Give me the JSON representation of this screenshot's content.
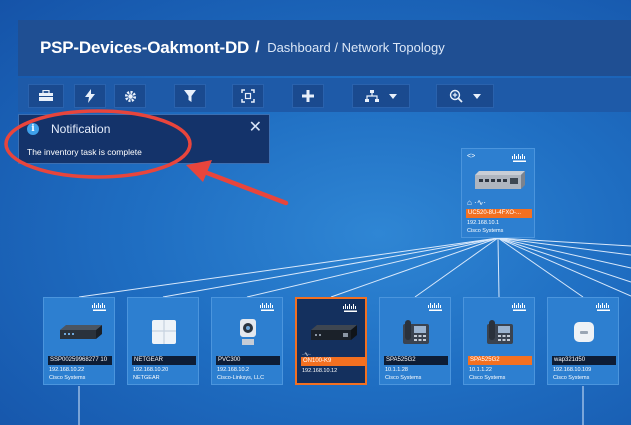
{
  "header": {
    "title": "PSP-Devices-Oakmont-DD",
    "breadcrumb_sep": "/",
    "breadcrumb": "Dashboard / Network Topology"
  },
  "toolbar": {
    "buttons": [
      {
        "icon": "toolbox-icon"
      },
      {
        "icon": "lightning-icon"
      },
      {
        "icon": "gear-icon"
      },
      {
        "icon": "filter-icon"
      },
      {
        "icon": "fit-screen-icon"
      },
      {
        "icon": "plus-icon"
      },
      {
        "icon": "layout-tree-icon"
      },
      {
        "icon": "zoom-in-icon"
      }
    ]
  },
  "notification": {
    "title": "Notification",
    "message": "The inventory task is complete",
    "close": "✕",
    "info": "i"
  },
  "root_device": {
    "code": "<>",
    "status": "⌂ ·∿·",
    "name": "UC520-8U-4FXO-...",
    "ip": "192.168.10.1",
    "vendor": "Cisco Systems"
  },
  "devices": [
    {
      "name": "SSP00259968277 10",
      "ip": "192.168.10.22",
      "vendor": "Cisco Systems",
      "kind": "switch",
      "highlight": false
    },
    {
      "name": "NETGEAR",
      "ip": "192.168.10.20",
      "vendor": "NETGEAR",
      "kind": "box",
      "highlight": false
    },
    {
      "name": "PVC300",
      "ip": "192.168.10.2",
      "vendor": "Cisco-Linksys, LLC",
      "kind": "camera",
      "highlight": false
    },
    {
      "name": "ON100-K9",
      "ip": "192.168.10.12",
      "vendor": "",
      "kind": "router",
      "highlight": true
    },
    {
      "name": "SPA525G2",
      "ip": "10.1.1.28",
      "vendor": "Cisco Systems",
      "kind": "phone",
      "highlight": false
    },
    {
      "name": "SPA525G2",
      "ip": "10.1.1.22",
      "vendor": "Cisco Systems",
      "kind": "phone",
      "highlight": true
    },
    {
      "name": "wap321d50",
      "ip": "192.168.10.109",
      "vendor": "Cisco Systems",
      "kind": "ap",
      "highlight": false
    }
  ],
  "colors": {
    "accent": "#f37021",
    "header": "#1f4f93",
    "annotation": "#e8453c"
  }
}
